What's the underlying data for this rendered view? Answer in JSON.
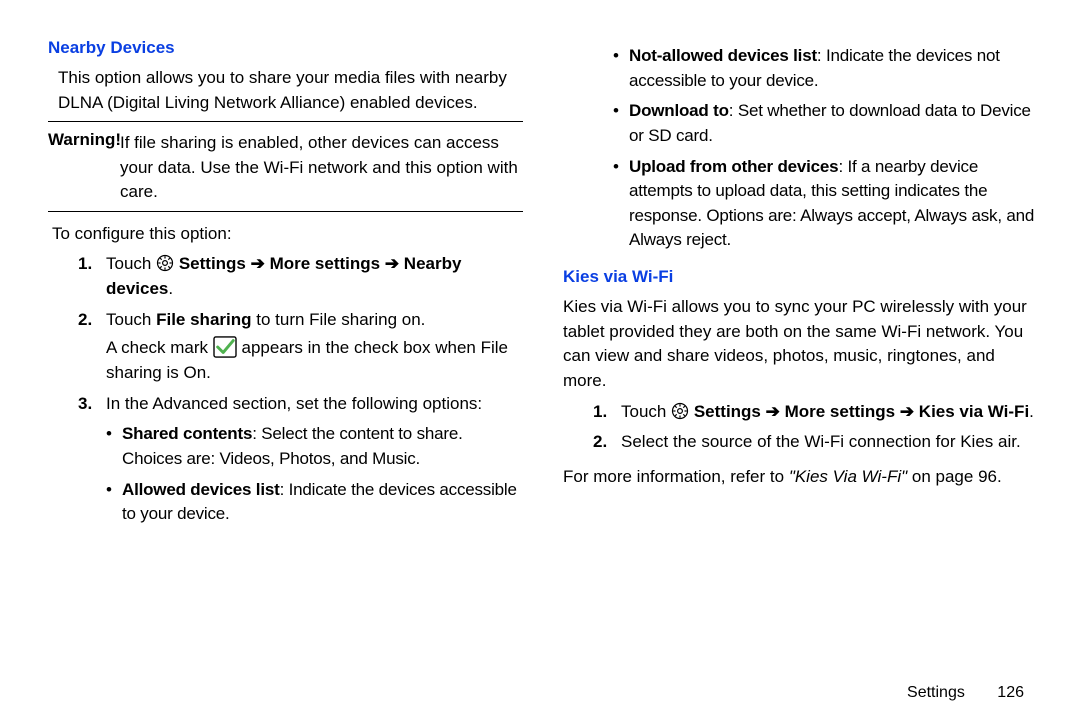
{
  "left": {
    "heading": "Nearby Devices",
    "intro": "This option allows you to share your media files with nearby DLNA (Digital Living Network Alliance) enabled devices.",
    "warning_label": "Warning!",
    "warning_body": "If file sharing is enabled, other devices can access your data. Use the Wi-Fi network and this option with care.",
    "configure": "To configure this option:",
    "step1_num": "1.",
    "step1_touch": "Touch ",
    "step1_path": " Settings ➔ More settings ➔ Nearby devices",
    "step1_dot": ".",
    "step2_num": "2.",
    "step2_a": "Touch ",
    "step2_b": "File sharing",
    "step2_c": " to turn File sharing on.",
    "step2_line2a": "A check mark ",
    "step2_line2b": " appears in the check box when File sharing is On.",
    "step3_num": "3.",
    "step3_text": "In the Advanced section, set the following options:",
    "b1_label": "Shared contents",
    "b1_rest": ": Select the content to share. Choices are: Videos, Photos, and Music.",
    "b2_label": "Allowed devices list",
    "b2_rest": ": Indicate the devices accessible to your device."
  },
  "right": {
    "b3_label": "Not-allowed devices list",
    "b3_rest": ": Indicate the devices not accessible to your device.",
    "b4_label": "Download to",
    "b4_rest": ": Set whether to download data to Device or SD card.",
    "b5_label": "Upload from other devices",
    "b5_rest": ": If a nearby device attempts to upload data, this setting indicates the response. Options are: Always accept, Always ask, and Always reject.",
    "heading": "Kies via Wi-Fi",
    "intro": "Kies via Wi-Fi allows you to sync your PC wirelessly with your tablet provided they are both on the same Wi-Fi network. You can view and share videos, photos, music, ringtones, and more.",
    "step1_num": "1.",
    "step1_touch": "Touch ",
    "step1_path": " Settings ➔ More settings ➔ Kies via Wi-Fi",
    "step1_dot": ".",
    "step2_num": "2.",
    "step2_text": "Select the source of the Wi-Fi connection for Kies air.",
    "more_a": "For more information, refer to ",
    "more_b": "\"Kies Via Wi-Fi\"",
    "more_c": " on page 96."
  },
  "footer": {
    "section": "Settings",
    "page": "126"
  },
  "glyphs": {
    "bullet": "•"
  }
}
